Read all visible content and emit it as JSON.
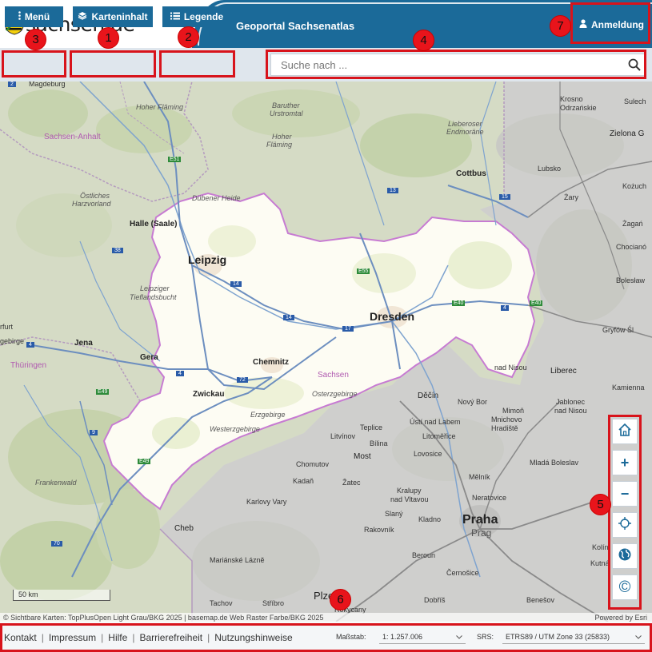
{
  "header": {
    "logo_text": "sachsen.de",
    "portal_title": "Geoportal Sachsenatlas",
    "login_label": "Anmeldung"
  },
  "toolbar": {
    "menu_label": "Menü",
    "content_label": "Karteninhalt",
    "legend_label": "Legende"
  },
  "search": {
    "placeholder": "Suche nach ..."
  },
  "markers": [
    "1",
    "2",
    "3",
    "4",
    "5",
    "6",
    "7"
  ],
  "map": {
    "labels": {
      "magdeburg": "Magdeburg",
      "hoher_flaming1": "Hoher Fläming",
      "baruther": "Baruther",
      "urstromtal": "Urstromtal",
      "krosno": "Krosno",
      "odrzańskie": "Odrzańskie",
      "sulech": "Sulech",
      "sachsen_anhalt": "Sachsen-Anhalt",
      "hoher_flaming2": "Hoher",
      "flaming2": "Fläming",
      "lieberoser": "Lieberoser",
      "endmorane": "Endmoräne",
      "zielona": "Zielona G",
      "lubsko": "Lubsko",
      "cottbus": "Cottbus",
      "ostliches": "Östliches",
      "harzvorland": "Harzvorland",
      "duebener": "Dübener Heide",
      "zary": "Żary",
      "kozuch": "Kożuch",
      "halle": "Halle (Saale)",
      "zagan": "Żagań",
      "leipzig": "Leipzig",
      "chocianow": "Chocianó",
      "leipziger": "Leipziger",
      "tieflandsbucht": "Tieflandsbucht",
      "boleslaw": "Bolesław",
      "dresden": "Dresden",
      "furt": "rfurt",
      "jena": "Jena",
      "gera": "Gera",
      "gryfow": "Gryfów Śl",
      "thueringen": "Thüringen",
      "chemnitz": "Chemnitz",
      "sachsen": "Sachsen",
      "osterzgebirge": "Osterzgebirge",
      "liberec": "Liberec",
      "zwickau": "Zwickau",
      "decin": "Děčín",
      "nad_nisou": "nad Nisou",
      "kamienna": "Kamienna",
      "erzgebirge": "Erzgebirge",
      "novy_bor": "Nový Bor",
      "jablonec": "Jablonec",
      "nad_nisou2": "nad Nisou",
      "westerz": "Westerzgebirge",
      "teplice": "Teplice",
      "usti": "Ústí nad Labem",
      "mimon": "Mimoň",
      "litvinov": "Litvínov",
      "bilina": "Bílina",
      "litomerice": "Litoměřice",
      "mnichovo": "Mnichovo",
      "hradiste": "Hradiště",
      "most": "Most",
      "lovosice": "Lovosice",
      "chomutov": "Chomutov",
      "mlada": "Mladá Boleslav",
      "frankenwald": "Frankenwald",
      "melnik": "Mělník",
      "zatec": "Žatec",
      "kralupy": "Kralupy",
      "nad_vltavou": "nad Vltavou",
      "neratovice": "Neratovice",
      "kadan": "Kadaň",
      "karlovy": "Karlovy Vary",
      "slany": "Slaný",
      "kladno": "Kladno",
      "praha": "Praha",
      "prag": "Prag",
      "cheb": "Cheb",
      "rakovnik": "Rakovník",
      "kolin": "Kolín",
      "marianske": "Mariánské Lázně",
      "beroun": "Beroun",
      "kutna": "Kutná",
      "cernosice": "Černošice",
      "tachov": "Tachov",
      "stribro": "Stříbro",
      "plzen": "Plzeň",
      "rokycany": "Rokycany",
      "dobris": "Dobříš",
      "benesov": "Benešov",
      "fichtel": "gebirge"
    },
    "roads": {
      "e51": "E51",
      "e55": "E55",
      "e40a": "E40",
      "e40b": "E40",
      "e49a": "E49",
      "e49b": "E49",
      "r14a": "14",
      "r14b": "14",
      "r17": "17",
      "r72": "72",
      "r4": "4",
      "r4b": "4",
      "r9": "9",
      "r38": "38",
      "r2": "2",
      "r13": "13",
      "r70": "70",
      "r15": "15",
      "r4c": "4"
    }
  },
  "map_controls": {
    "home": "home-icon",
    "zoom_in": "+",
    "zoom_out": "−",
    "locate": "locate-icon",
    "basemap": "globe-icon",
    "copyright": "©"
  },
  "scalebar": {
    "label": "50 km"
  },
  "attribution": {
    "text": "© Sichtbare Karten: TopPlusOpen Light Grau/BKG 2025 | basemap.de Web Raster Farbe/BKG 2025",
    "powered": "Powered by Esri"
  },
  "footer": {
    "links": [
      "Kontakt",
      "Impressum",
      "Hilfe",
      "Barrierefreiheit",
      "Nutzungshinweise"
    ],
    "scale_label": "Maßstab:",
    "scale_value": "1: 1.257.006",
    "srs_label": "SRS:",
    "srs_value": "ETRS89 / UTM Zone 33 (25833)"
  },
  "colors": {
    "brand_blue": "#1b6a99",
    "annotation_red": "#d8131b",
    "saxony_fill": "#fdfcf3",
    "border_purple": "#c77bd2"
  }
}
